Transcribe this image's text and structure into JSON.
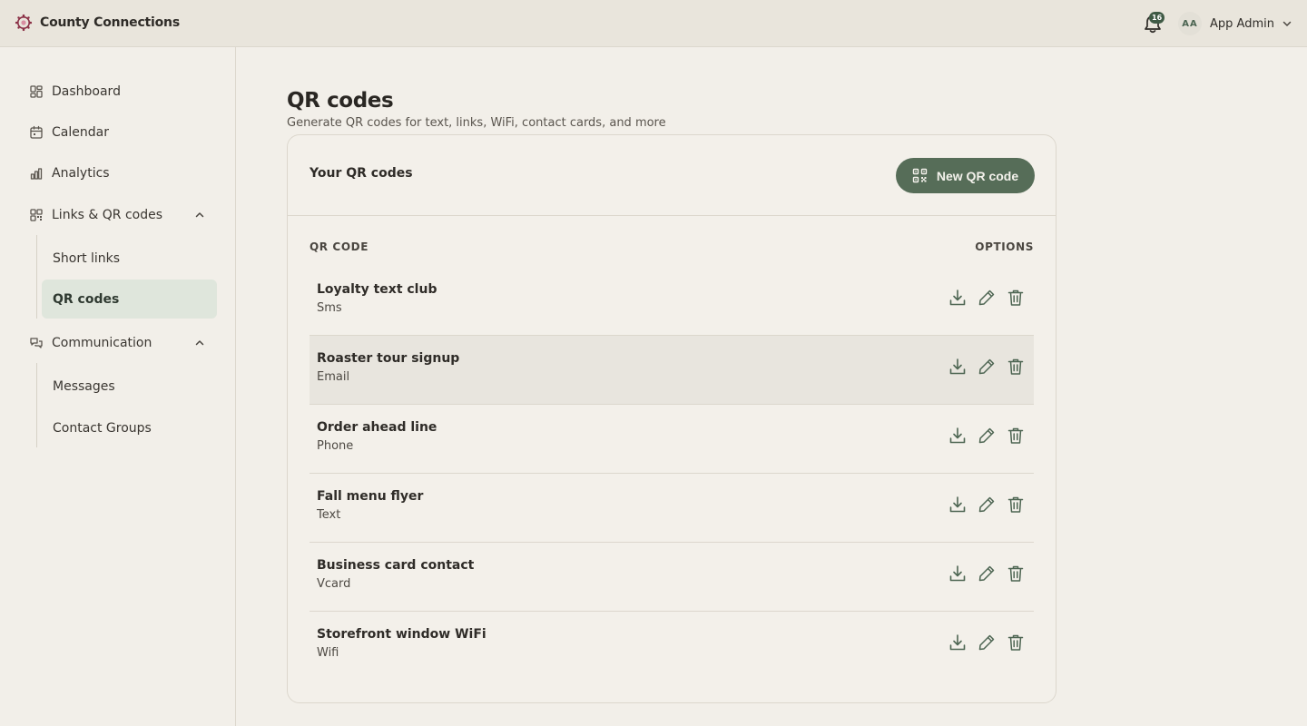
{
  "app": {
    "name": "County Connections"
  },
  "header": {
    "notifications_count": "16",
    "user_initials": "AA",
    "user_name": "App Admin"
  },
  "sidebar": {
    "items": [
      {
        "label": "Dashboard",
        "icon": "dashboard-icon"
      },
      {
        "label": "Calendar",
        "icon": "calendar-icon"
      },
      {
        "label": "Analytics",
        "icon": "analytics-icon"
      },
      {
        "label": "Links & QR codes",
        "icon": "qr-grid-icon",
        "expanded": true,
        "children": [
          {
            "label": "Short links"
          },
          {
            "label": "QR codes",
            "active": true
          }
        ]
      },
      {
        "label": "Communication",
        "icon": "chat-icon",
        "expanded": true,
        "children": [
          {
            "label": "Messages"
          },
          {
            "label": "Contact Groups"
          }
        ]
      }
    ]
  },
  "page": {
    "title": "QR codes",
    "subtitle": "Generate QR codes for text, links, WiFi, contact cards, and more"
  },
  "card": {
    "title": "Your QR codes",
    "new_button": "New QR code",
    "columns": {
      "name": "QR CODE",
      "options": "OPTIONS"
    },
    "rows": [
      {
        "name": "Loyalty text club",
        "type": "Sms"
      },
      {
        "name": "Roaster tour signup",
        "type": "Email"
      },
      {
        "name": "Order ahead line",
        "type": "Phone"
      },
      {
        "name": "Fall menu flyer",
        "type": "Text"
      },
      {
        "name": "Business card contact",
        "type": "Vcard"
      },
      {
        "name": "Storefront window WiFi",
        "type": "Wifi"
      }
    ]
  },
  "colors": {
    "accent": "#566d58",
    "active_nav": "#dfe6dc",
    "background": "#f2efe9",
    "brand_logo": "#8a2f45"
  }
}
